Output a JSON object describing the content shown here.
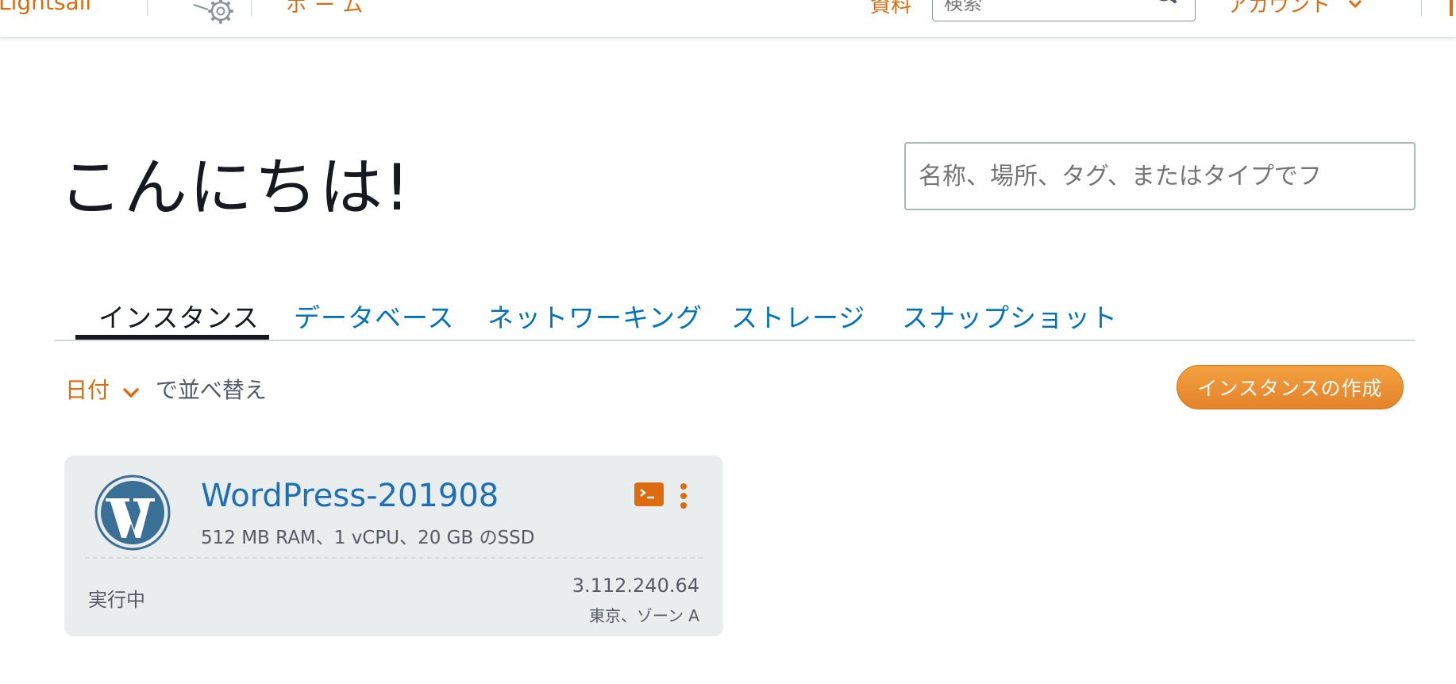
{
  "header": {
    "brand": "Lightsail",
    "home_label": "ホーム",
    "docs_label": "資料",
    "search_placeholder": "検索",
    "account_label": "アカウント"
  },
  "greeting": "こんにちは!",
  "filter": {
    "placeholder": "名称、場所、タグ、またはタイプでフ"
  },
  "tabs": [
    {
      "label": "インスタンス",
      "active": true
    },
    {
      "label": "データベース",
      "active": false
    },
    {
      "label": "ネットワーキング",
      "active": false
    },
    {
      "label": "ストレージ",
      "active": false
    },
    {
      "label": "スナップショット",
      "active": false
    }
  ],
  "sort": {
    "key": "日付",
    "suffix": "で並べ替え"
  },
  "create_button": "インスタンスの作成",
  "instances": [
    {
      "name": "WordPress-201908",
      "spec": "512 MB RAM、1 vCPU、20 GB のSSD",
      "status": "実行中",
      "ip": "3.112.240.64",
      "zone": "東京、ゾーン A",
      "icon": "wordpress-icon"
    }
  ],
  "colors": {
    "accent_orange": "#dd6b10",
    "link_blue": "#0073bb",
    "card_bg": "#eaeded",
    "wordpress_blue": "#3a6f96"
  }
}
